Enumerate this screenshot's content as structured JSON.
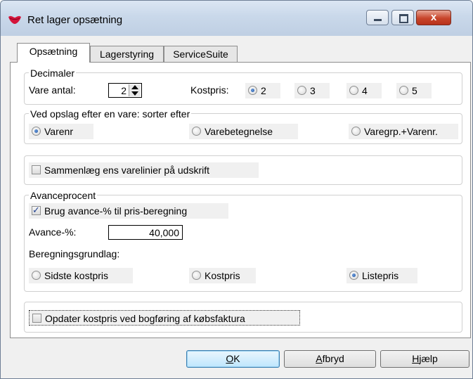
{
  "window": {
    "title": "Ret lager opsætning",
    "close_glyph": "x",
    "app_icon": "red-lips-icon"
  },
  "tabs": [
    {
      "label": "Opsætning",
      "active": true
    },
    {
      "label": "Lagerstyring",
      "active": false
    },
    {
      "label": "ServiceSuite",
      "active": false
    }
  ],
  "decimaler": {
    "legend": "Decimaler",
    "vare_antal_label": "Vare antal:",
    "vare_antal_value": "2",
    "kostpris_label": "Kostpris:",
    "kostpris_options": [
      "2",
      "3",
      "4",
      "5"
    ],
    "kostpris_selected": "2"
  },
  "sort": {
    "legend": "Ved opslag efter en vare: sorter efter",
    "options": [
      "Varenr",
      "Varebetegnelse",
      "Varegrp.+Varenr."
    ],
    "selected": "Varenr"
  },
  "sammenlaeg": {
    "label": "Sammenlæg ens varelinier på udskrift",
    "checked": false
  },
  "avance": {
    "legend": "Avanceprocent",
    "brug_label": "Brug avance-% til pris-beregning",
    "brug_checked": true,
    "pct_label": "Avance-%:",
    "pct_value": "40,000",
    "grundlag_label": "Beregningsgrundlag:",
    "grundlag_options": [
      "Sidste kostpris",
      "Kostpris",
      "Listepris"
    ],
    "grundlag_selected": "Listepris"
  },
  "opdater": {
    "label": "Opdater kostpris ved bogføring af købsfaktura",
    "checked": false
  },
  "buttons": {
    "ok_hot": "O",
    "ok_rest": "K",
    "afbryd_hot": "A",
    "afbryd_rest": "fbryd",
    "hjaelp_hot": "H",
    "hjaelp_rest": "jælp"
  },
  "colors": {
    "accent": "#1b4e9c",
    "close_button": "#c7452b",
    "title_bar": "#c9d8ea"
  }
}
